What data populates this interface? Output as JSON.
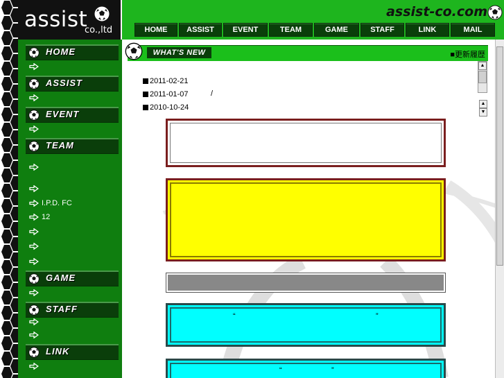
{
  "logo": {
    "word": "assist",
    "suffix": "co.,ltd"
  },
  "header": {
    "brand": "assist-co.com"
  },
  "topnav": [
    {
      "label": "HOME"
    },
    {
      "label": "ASSIST"
    },
    {
      "label": "EVENT"
    },
    {
      "label": "TEAM"
    },
    {
      "label": "GAME"
    },
    {
      "label": "STAFF"
    },
    {
      "label": "LINK"
    },
    {
      "label": "MAIL"
    }
  ],
  "sidebar": {
    "sections": [
      {
        "label": "HOME"
      },
      {
        "label": "ASSIST"
      },
      {
        "label": "EVENT"
      },
      {
        "label": "TEAM"
      },
      {
        "label": "GAME"
      },
      {
        "label": "STAFF"
      },
      {
        "label": "LINK"
      }
    ],
    "team_items": [
      "",
      "",
      "I.P.D. FC",
      "12",
      "",
      "",
      ""
    ]
  },
  "news": {
    "title": "WHAT'S NEW",
    "archive_label": "■更新履歴",
    "dates": [
      "2011-02-21",
      "2011-01-07",
      "2010-10-24"
    ],
    "slash": "/"
  },
  "quotes": {
    "q4_open": "“",
    "q4_close": "”",
    "q5_open": "“",
    "q5_close": "”"
  },
  "colors": {
    "brand_green": "#1eb51e",
    "sidebar_green": "#0f7e0f",
    "nav_dark": "#0a3f0a",
    "yellow_box": "#ffff00",
    "cyan_box": "#00ffff"
  }
}
